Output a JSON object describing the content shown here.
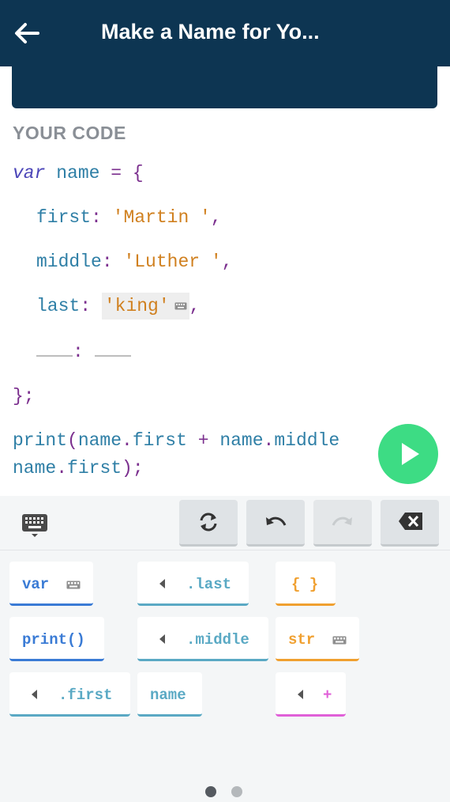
{
  "header": {
    "title": "Make a Name for Yo..."
  },
  "section": {
    "label": "YOUR CODE"
  },
  "code": {
    "line1": {
      "kw": "var",
      "name": "name",
      "eq": "=",
      "brace": "{"
    },
    "line2": {
      "key": "first",
      "colon": ":",
      "value": "'Martin '",
      "comma": ","
    },
    "line3": {
      "key": "middle",
      "colon": ":",
      "value": "'Luther '",
      "comma": ","
    },
    "line4": {
      "key": "last",
      "colon": ":",
      "value": "'king'",
      "comma": ","
    },
    "line5": {
      "colon": ":"
    },
    "line6": {
      "close": "};"
    },
    "line7": {
      "fn": "print",
      "paren": "(",
      "a": "name",
      "dot1": ".",
      "b": "first",
      "plus": "+",
      "c": "name",
      "dot2": ".",
      "d": "middle"
    },
    "line8": {
      "a": "name",
      "dot": ".",
      "b": "first",
      "end": ");"
    }
  },
  "chips": {
    "var": "var",
    "last": ".last",
    "braces": "{ }",
    "print": "print()",
    "middle": ".middle",
    "str": "str",
    "first": ".first",
    "name": "name",
    "plus": "+"
  },
  "colors": {
    "appbar": "#0d3552",
    "run": "#3ddc84",
    "keyword": "#4b45b8",
    "identifier": "#2f7fa6",
    "string": "#d0801f",
    "punct": "#7b2f8e",
    "chip_blue": "#3a7bd5",
    "chip_teal": "#5aa9c4",
    "chip_orange": "#f0a030",
    "chip_pink": "#e060d8"
  },
  "pager": {
    "pages": 2,
    "current": 1
  }
}
